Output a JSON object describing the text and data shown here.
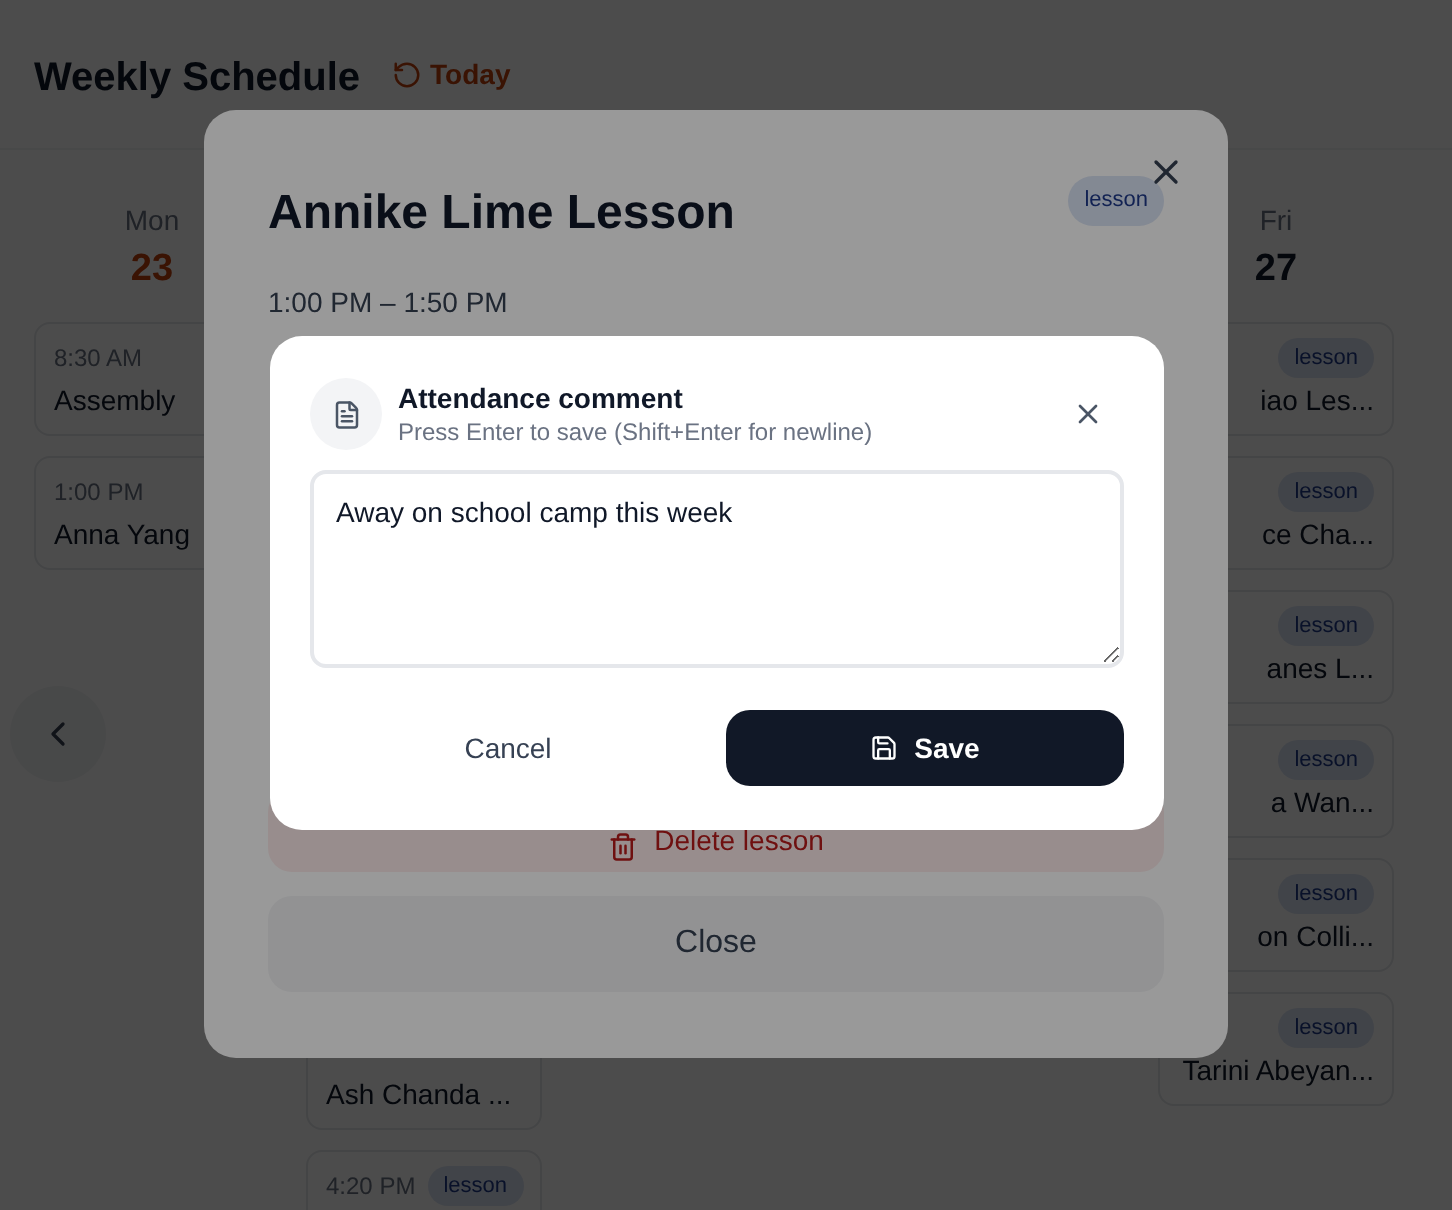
{
  "header": {
    "title": "Weekly Schedule",
    "today_button": "Today"
  },
  "days": [
    {
      "weekday": "Mon",
      "date": "23",
      "today": true,
      "events": [
        {
          "time": "8:30 AM",
          "title": "Assembly"
        },
        {
          "time": "1:00 PM",
          "title": "Anna Yang"
        }
      ]
    },
    {
      "events": [
        {
          "title": "Ash Chanda ..."
        },
        {
          "time": "4:20 PM",
          "tag": "lesson"
        }
      ]
    },
    {
      "weekday": "Fri",
      "date": "27",
      "today": false,
      "events": [
        {
          "tag": "lesson",
          "title": "iao Les..."
        },
        {
          "tag": "lesson",
          "title": "ce Cha..."
        },
        {
          "tag": "lesson",
          "title": "anes L..."
        },
        {
          "tag": "lesson",
          "title": "a Wan..."
        },
        {
          "tag": "lesson",
          "title": "on Colli..."
        },
        {
          "tag": "lesson",
          "title": "Tarini Abeyan..."
        }
      ]
    }
  ],
  "lesson_dialog": {
    "title": "Annike Lime Lesson",
    "tag": "lesson",
    "time": "1:00 PM – 1:50 PM",
    "delete_button": "Delete lesson",
    "close_button": "Close"
  },
  "comment_dialog": {
    "title": "Attendance comment",
    "hint": "Press Enter to save (Shift+Enter for newline)",
    "value": "Away on school camp this week",
    "cancel_button": "Cancel",
    "save_button": "Save"
  }
}
